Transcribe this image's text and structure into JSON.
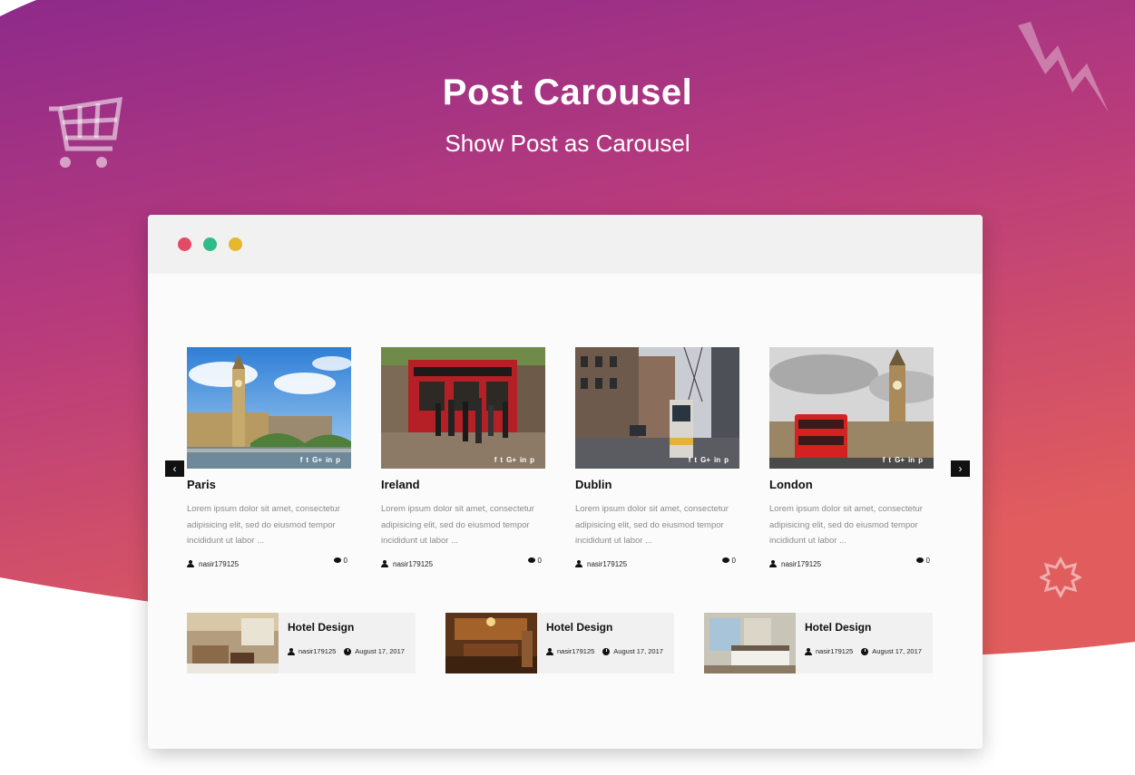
{
  "hero": {
    "title": "Post Carousel",
    "subtitle": "Show Post as Carousel"
  },
  "colors": {
    "gradient_top": "#8e2a8b",
    "gradient_bottom": "#e15d5d",
    "dot_red": "#e24a66",
    "dot_green": "#2ebd88",
    "dot_yellow": "#e6b82e"
  },
  "decorations": [
    "shopping-cart-icon",
    "zigzag-icon",
    "star-badge-icon"
  ],
  "carousel": {
    "prev_label": "‹",
    "next_label": "›",
    "posts": [
      {
        "title": "Paris",
        "excerpt": "Lorem ipsum dolor sit amet, consectetur adipisicing elit, sed do eiusmod tempor incididunt ut labor ...",
        "author": "nasir179125",
        "comments": "0",
        "image": "big-ben-bridge-photo"
      },
      {
        "title": "Ireland",
        "excerpt": "Lorem ipsum dolor sit amet, consectetur adipisicing elit, sed do eiusmod tempor incididunt ut labor ...",
        "author": "nasir179125",
        "comments": "0",
        "image": "red-pub-street-photo"
      },
      {
        "title": "Dublin",
        "excerpt": "Lorem ipsum dolor sit amet, consectetur adipisicing elit, sed do eiusmod tempor incididunt ut labor ...",
        "author": "nasir179125",
        "comments": "0",
        "image": "tram-street-photo"
      },
      {
        "title": "London",
        "excerpt": "Lorem ipsum dolor sit amet, consectetur adipisicing elit, sed do eiusmod tempor incididunt ut labor ...",
        "author": "nasir179125",
        "comments": "0",
        "image": "red-bus-big-ben-photo"
      }
    ],
    "social": [
      "f",
      "t",
      "G+",
      "in",
      "p"
    ]
  },
  "hotels": [
    {
      "title": "Hotel Design",
      "author": "nasir179125",
      "date": "August 17, 2017"
    },
    {
      "title": "Hotel Design",
      "author": "nasir179125",
      "date": "August 17, 2017"
    },
    {
      "title": "Hotel Design",
      "author": "nasir179125",
      "date": "August 17, 2017"
    }
  ]
}
